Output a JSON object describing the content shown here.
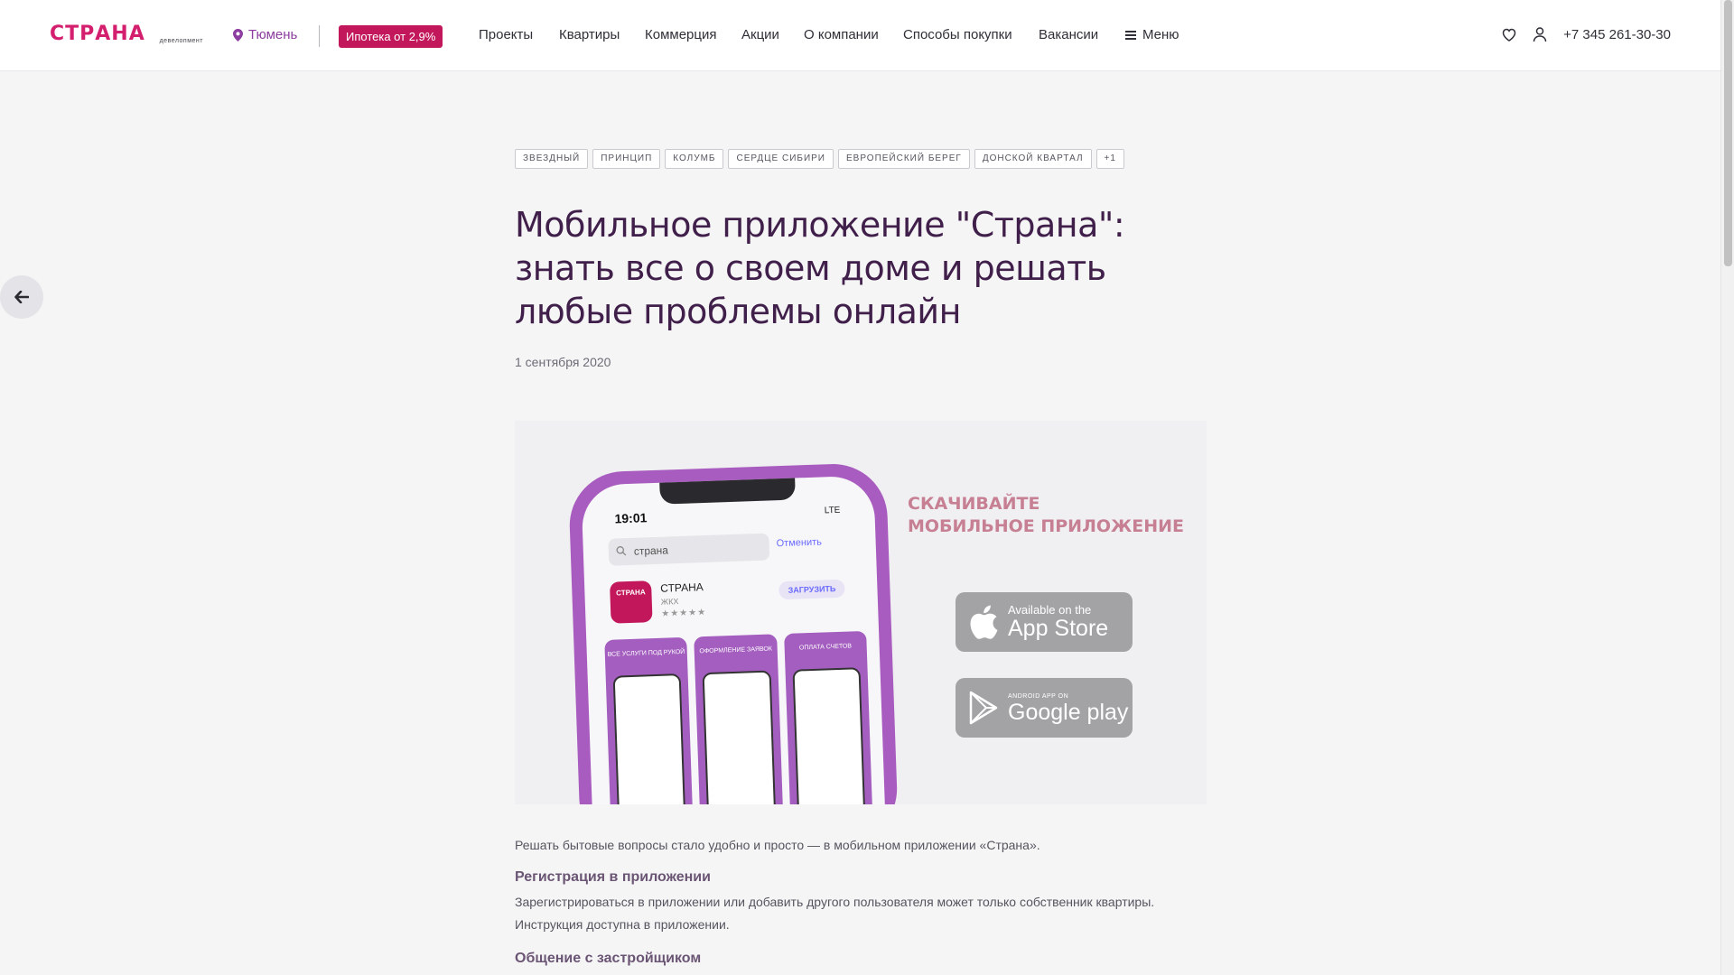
{
  "header": {
    "logo": "СТРАНА",
    "logo_sub": "девелопмент",
    "city": "Тюмень",
    "mortgage": "Ипотека от 2,9%",
    "nav": [
      "Проекты",
      "Квартиры",
      "Коммерция",
      "Акции",
      "О компании",
      "Способы покупки",
      "Вакансии"
    ],
    "menu_label": "Меню",
    "phone": "+7 345 261-30-30"
  },
  "article": {
    "tags": [
      "ЗВЕЗДНЫЙ",
      "ПРИНЦИП",
      "КОЛУМБ",
      "СЕРДЦЕ СИБИРИ",
      "ЕВРОПЕЙСКИЙ БЕРЕГ",
      "ДОНСКОЙ КВАРТАЛ",
      "+1"
    ],
    "title": "Мобильное приложение \"Страна\": знать все о своем доме и решать любые проблемы онлайн",
    "date": "1 сентября 2020",
    "hero": {
      "time": "19:01",
      "status": "LTE",
      "search_text": "страна",
      "cancel": "Отменить",
      "app_icon": "СТРАНА",
      "app_name": "СТРАНА",
      "app_sub": "ЖКХ",
      "app_stars": "★★★★★",
      "get_label": "ЗАГРУЗИТЬ",
      "shots": [
        "ВСЕ УСЛУГИ ПОД РУКОЙ",
        "ОФОРМЛЕНИЕ ЗАЯВОК",
        "ОПЛАТА СЧЕТОВ"
      ],
      "promo_line1": "СКАЧИВАЙТЕ",
      "promo_line2": "МОБИЛЬНОЕ ПРИЛОЖЕНИЕ",
      "apple_small": "Available on the",
      "apple_big": "App Store",
      "google_small": "ANDROID APP ON",
      "google_big": "Google play"
    },
    "lead": "Решать бытовые вопросы стало удобно и просто — в мобильном приложении «Страна».",
    "section1_title": "Регистрация в приложении",
    "section1_text": "Зарегистрироваться в приложении или добавить другого пользователя может только собственник квартиры. Инструкция доступна в приложении.",
    "section2_title": "Общение с застройщиком"
  },
  "colors": {
    "brand": "#c2185b",
    "accent_purple": "#8c3d9f",
    "title": "#40204a"
  }
}
